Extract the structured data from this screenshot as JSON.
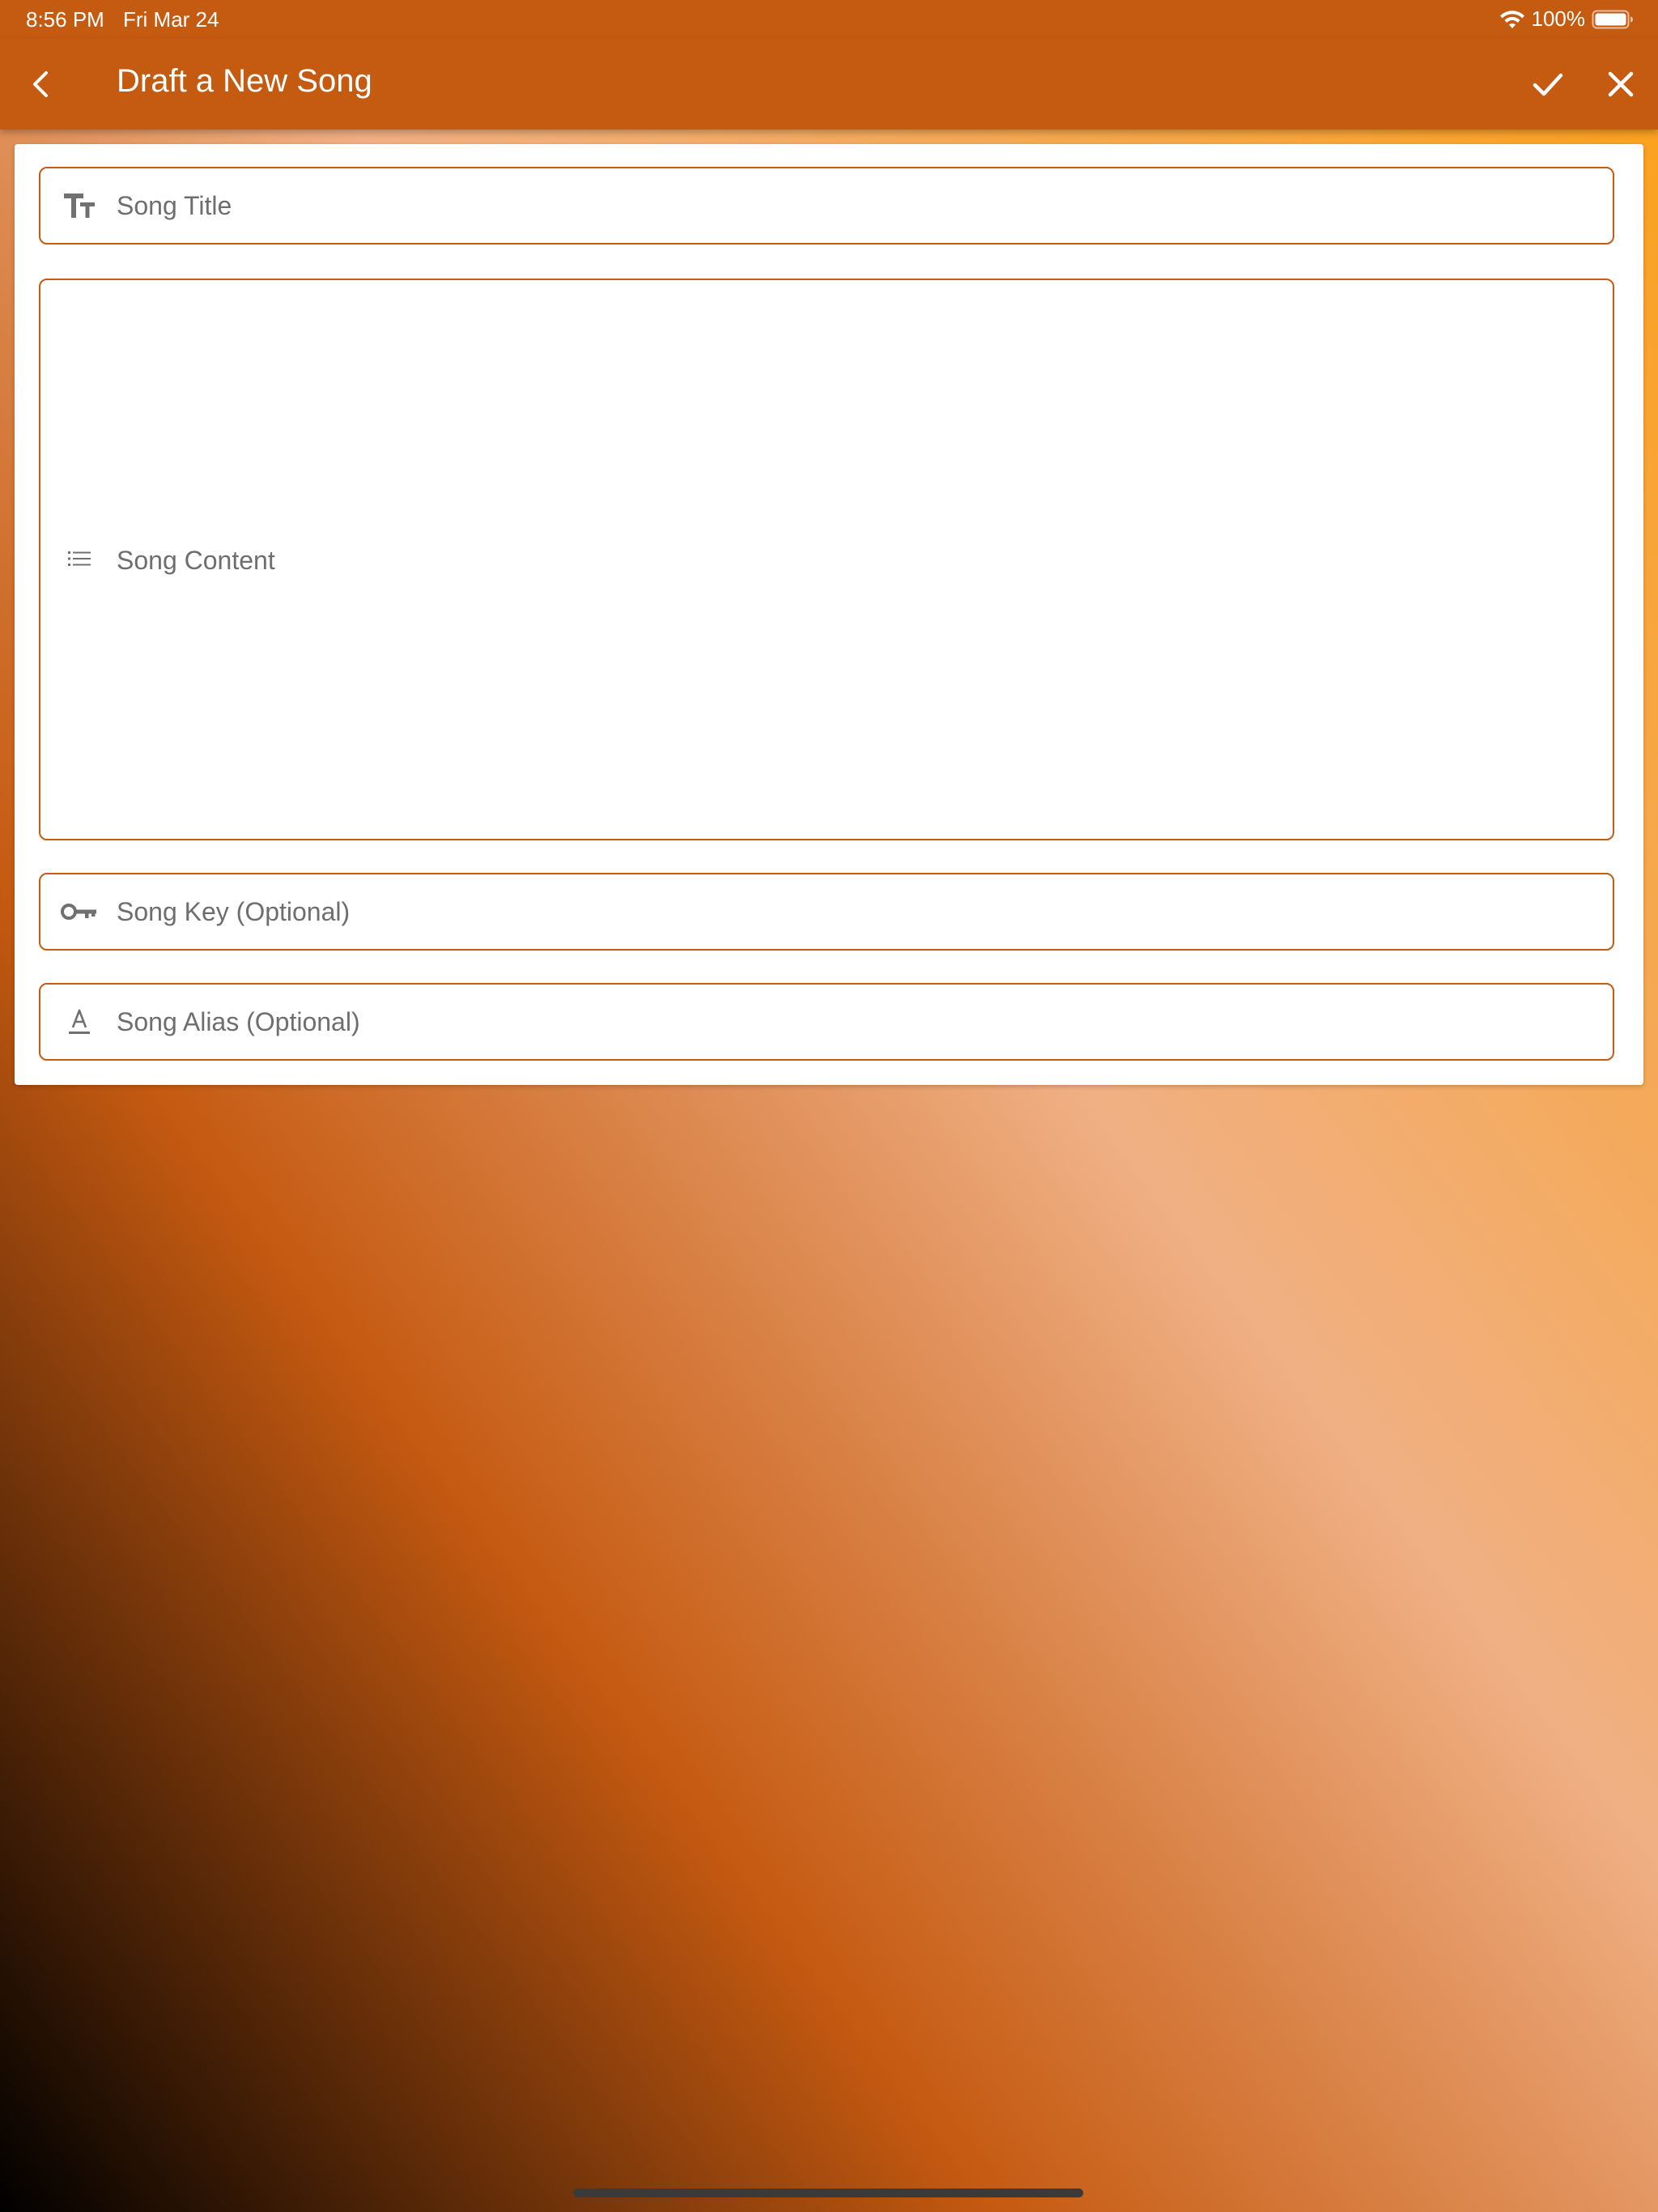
{
  "status_bar": {
    "time": "8:56 PM",
    "date": "Fri Mar 24",
    "battery": "100%",
    "wifi_icon": "wifi-icon",
    "battery_icon": "battery-full-icon"
  },
  "app_bar": {
    "title": "Draft a New Song",
    "back_icon": "chevron-left-icon",
    "save_icon": "checkmark-icon",
    "close_icon": "close-icon",
    "background_color": "#c55a11"
  },
  "form": {
    "title_field": {
      "placeholder": "Song Title",
      "value": "",
      "icon": "text-size-icon"
    },
    "content_field": {
      "placeholder": "Song Content",
      "value": "",
      "icon": "list-icon"
    },
    "key_field": {
      "placeholder": "Song Key (Optional)",
      "value": "",
      "icon": "key-icon"
    },
    "alias_field": {
      "placeholder": "Song Alias (Optional)",
      "value": "",
      "icon": "text-format-icon"
    },
    "border_color": "#c55a11"
  }
}
